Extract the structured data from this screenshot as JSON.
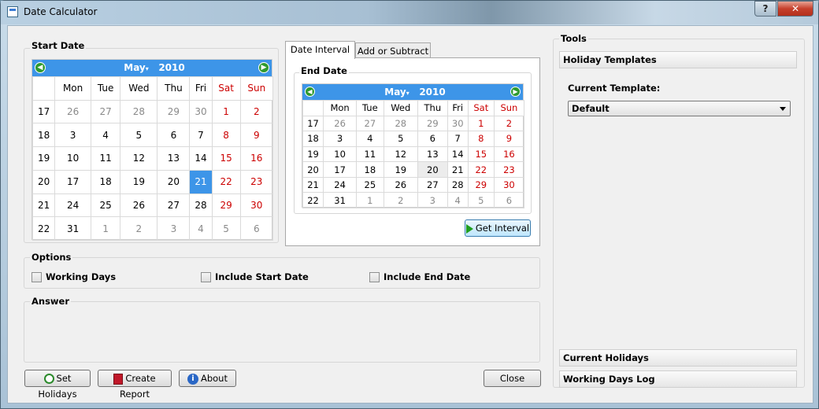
{
  "window": {
    "title": "Date Calculator",
    "help": "?",
    "close": "✕"
  },
  "start_date": {
    "group_title": "Start Date",
    "month": "May",
    "year": "2010",
    "weekdays": [
      "Mon",
      "Tue",
      "Wed",
      "Thu",
      "Fri",
      "Sat",
      "Sun"
    ],
    "weeks": [
      {
        "wk": "17",
        "days": [
          "26",
          "27",
          "28",
          "29",
          "30",
          "1",
          "2"
        ]
      },
      {
        "wk": "18",
        "days": [
          "3",
          "4",
          "5",
          "6",
          "7",
          "8",
          "9"
        ]
      },
      {
        "wk": "19",
        "days": [
          "10",
          "11",
          "12",
          "13",
          "14",
          "15",
          "16"
        ]
      },
      {
        "wk": "20",
        "days": [
          "17",
          "18",
          "19",
          "20",
          "21",
          "22",
          "23"
        ]
      },
      {
        "wk": "21",
        "days": [
          "24",
          "25",
          "26",
          "27",
          "28",
          "29",
          "30"
        ]
      },
      {
        "wk": "22",
        "days": [
          "31",
          "1",
          "2",
          "3",
          "4",
          "5",
          "6"
        ]
      }
    ],
    "selected_day": "21"
  },
  "tabs": [
    {
      "label": "Date Interval",
      "active": true
    },
    {
      "label": "Add or Subtract",
      "active": false
    }
  ],
  "end_date": {
    "group_title": "End Date",
    "month": "May",
    "year": "2010",
    "weekdays": [
      "Mon",
      "Tue",
      "Wed",
      "Thu",
      "Fri",
      "Sat",
      "Sun"
    ],
    "weeks": [
      {
        "wk": "17",
        "days": [
          "26",
          "27",
          "28",
          "29",
          "30",
          "1",
          "2"
        ]
      },
      {
        "wk": "18",
        "days": [
          "3",
          "4",
          "5",
          "6",
          "7",
          "8",
          "9"
        ]
      },
      {
        "wk": "19",
        "days": [
          "10",
          "11",
          "12",
          "13",
          "14",
          "15",
          "16"
        ]
      },
      {
        "wk": "20",
        "days": [
          "17",
          "18",
          "19",
          "20",
          "21",
          "22",
          "23"
        ]
      },
      {
        "wk": "21",
        "days": [
          "24",
          "25",
          "26",
          "27",
          "28",
          "29",
          "30"
        ]
      },
      {
        "wk": "22",
        "days": [
          "31",
          "1",
          "2",
          "3",
          "4",
          "5",
          "6"
        ]
      }
    ],
    "today_day": "20"
  },
  "get_interval_label": "Get Interval",
  "options": {
    "group_title": "Options",
    "working_days": "Working Days",
    "include_start": "Include Start Date",
    "include_end": "Include End Date"
  },
  "answer": {
    "group_title": "Answer"
  },
  "buttons": {
    "set_holidays": "Set Holidays",
    "create_report": "Create Report",
    "about": "About",
    "close": "Close"
  },
  "tools": {
    "group_title": "Tools",
    "holiday_templates": "Holiday Templates",
    "current_template_label": "Current Template:",
    "current_template_value": "Default",
    "current_holidays": "Current Holidays",
    "working_days_log": "Working Days Log"
  },
  "colors": {
    "accent": "#3d95e8",
    "weekend": "#cc0000",
    "other_month": "#8a8a8a"
  }
}
